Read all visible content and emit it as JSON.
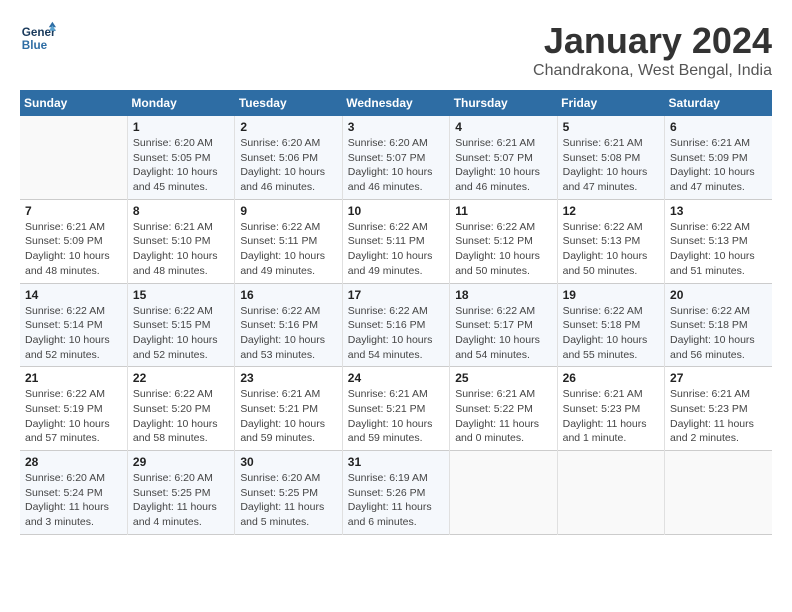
{
  "logo": {
    "line1": "General",
    "line2": "Blue"
  },
  "title": "January 2024",
  "subtitle": "Chandrakona, West Bengal, India",
  "days_of_week": [
    "Sunday",
    "Monday",
    "Tuesday",
    "Wednesday",
    "Thursday",
    "Friday",
    "Saturday"
  ],
  "weeks": [
    [
      {
        "num": "",
        "info": ""
      },
      {
        "num": "1",
        "info": "Sunrise: 6:20 AM\nSunset: 5:05 PM\nDaylight: 10 hours\nand 45 minutes."
      },
      {
        "num": "2",
        "info": "Sunrise: 6:20 AM\nSunset: 5:06 PM\nDaylight: 10 hours\nand 46 minutes."
      },
      {
        "num": "3",
        "info": "Sunrise: 6:20 AM\nSunset: 5:07 PM\nDaylight: 10 hours\nand 46 minutes."
      },
      {
        "num": "4",
        "info": "Sunrise: 6:21 AM\nSunset: 5:07 PM\nDaylight: 10 hours\nand 46 minutes."
      },
      {
        "num": "5",
        "info": "Sunrise: 6:21 AM\nSunset: 5:08 PM\nDaylight: 10 hours\nand 47 minutes."
      },
      {
        "num": "6",
        "info": "Sunrise: 6:21 AM\nSunset: 5:09 PM\nDaylight: 10 hours\nand 47 minutes."
      }
    ],
    [
      {
        "num": "7",
        "info": "Sunrise: 6:21 AM\nSunset: 5:09 PM\nDaylight: 10 hours\nand 48 minutes."
      },
      {
        "num": "8",
        "info": "Sunrise: 6:21 AM\nSunset: 5:10 PM\nDaylight: 10 hours\nand 48 minutes."
      },
      {
        "num": "9",
        "info": "Sunrise: 6:22 AM\nSunset: 5:11 PM\nDaylight: 10 hours\nand 49 minutes."
      },
      {
        "num": "10",
        "info": "Sunrise: 6:22 AM\nSunset: 5:11 PM\nDaylight: 10 hours\nand 49 minutes."
      },
      {
        "num": "11",
        "info": "Sunrise: 6:22 AM\nSunset: 5:12 PM\nDaylight: 10 hours\nand 50 minutes."
      },
      {
        "num": "12",
        "info": "Sunrise: 6:22 AM\nSunset: 5:13 PM\nDaylight: 10 hours\nand 50 minutes."
      },
      {
        "num": "13",
        "info": "Sunrise: 6:22 AM\nSunset: 5:13 PM\nDaylight: 10 hours\nand 51 minutes."
      }
    ],
    [
      {
        "num": "14",
        "info": "Sunrise: 6:22 AM\nSunset: 5:14 PM\nDaylight: 10 hours\nand 52 minutes."
      },
      {
        "num": "15",
        "info": "Sunrise: 6:22 AM\nSunset: 5:15 PM\nDaylight: 10 hours\nand 52 minutes."
      },
      {
        "num": "16",
        "info": "Sunrise: 6:22 AM\nSunset: 5:16 PM\nDaylight: 10 hours\nand 53 minutes."
      },
      {
        "num": "17",
        "info": "Sunrise: 6:22 AM\nSunset: 5:16 PM\nDaylight: 10 hours\nand 54 minutes."
      },
      {
        "num": "18",
        "info": "Sunrise: 6:22 AM\nSunset: 5:17 PM\nDaylight: 10 hours\nand 54 minutes."
      },
      {
        "num": "19",
        "info": "Sunrise: 6:22 AM\nSunset: 5:18 PM\nDaylight: 10 hours\nand 55 minutes."
      },
      {
        "num": "20",
        "info": "Sunrise: 6:22 AM\nSunset: 5:18 PM\nDaylight: 10 hours\nand 56 minutes."
      }
    ],
    [
      {
        "num": "21",
        "info": "Sunrise: 6:22 AM\nSunset: 5:19 PM\nDaylight: 10 hours\nand 57 minutes."
      },
      {
        "num": "22",
        "info": "Sunrise: 6:22 AM\nSunset: 5:20 PM\nDaylight: 10 hours\nand 58 minutes."
      },
      {
        "num": "23",
        "info": "Sunrise: 6:21 AM\nSunset: 5:21 PM\nDaylight: 10 hours\nand 59 minutes."
      },
      {
        "num": "24",
        "info": "Sunrise: 6:21 AM\nSunset: 5:21 PM\nDaylight: 10 hours\nand 59 minutes."
      },
      {
        "num": "25",
        "info": "Sunrise: 6:21 AM\nSunset: 5:22 PM\nDaylight: 11 hours\nand 0 minutes."
      },
      {
        "num": "26",
        "info": "Sunrise: 6:21 AM\nSunset: 5:23 PM\nDaylight: 11 hours\nand 1 minute."
      },
      {
        "num": "27",
        "info": "Sunrise: 6:21 AM\nSunset: 5:23 PM\nDaylight: 11 hours\nand 2 minutes."
      }
    ],
    [
      {
        "num": "28",
        "info": "Sunrise: 6:20 AM\nSunset: 5:24 PM\nDaylight: 11 hours\nand 3 minutes."
      },
      {
        "num": "29",
        "info": "Sunrise: 6:20 AM\nSunset: 5:25 PM\nDaylight: 11 hours\nand 4 minutes."
      },
      {
        "num": "30",
        "info": "Sunrise: 6:20 AM\nSunset: 5:25 PM\nDaylight: 11 hours\nand 5 minutes."
      },
      {
        "num": "31",
        "info": "Sunrise: 6:19 AM\nSunset: 5:26 PM\nDaylight: 11 hours\nand 6 minutes."
      },
      {
        "num": "",
        "info": ""
      },
      {
        "num": "",
        "info": ""
      },
      {
        "num": "",
        "info": ""
      }
    ]
  ]
}
